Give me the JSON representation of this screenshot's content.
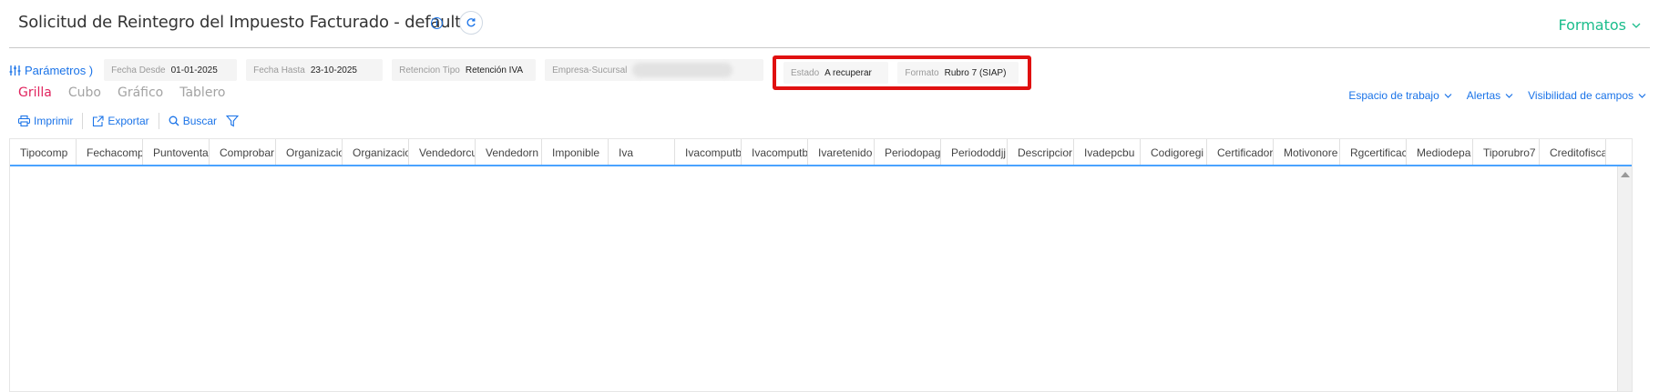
{
  "header": {
    "title": "Solicitud de Reintegro del Impuesto Facturado - default",
    "formatos_label": "Formatos"
  },
  "params": {
    "toggle_label": "Parámetros )",
    "fecha_desde": {
      "label": "Fecha Desde",
      "value": "01-01-2025"
    },
    "fecha_hasta": {
      "label": "Fecha Hasta",
      "value": "23-10-2025"
    },
    "retencion_tipo": {
      "label": "Retencion Tipo",
      "value": "Retención IVA"
    },
    "empresa_sucursal": {
      "label": "Empresa-Sucursal",
      "value": ""
    },
    "estado": {
      "label": "Estado",
      "value": "A recuperar"
    },
    "formato": {
      "label": "Formato",
      "value": "Rubro 7 (SIAP)"
    }
  },
  "view_tabs": [
    "Grilla",
    "Cubo",
    "Gráfico",
    "Tablero"
  ],
  "right_menu": [
    "Espacio de trabajo",
    "Alertas",
    "Visibilidad de campos"
  ],
  "toolbar": {
    "imprimir": "Imprimir",
    "exportar": "Exportar",
    "buscar": "Buscar"
  },
  "grid": {
    "columns": [
      "Tipocomp",
      "Fechacomp",
      "Puntoventa",
      "Comprobar",
      "Organizacio",
      "Organizacio",
      "Vendedorcu",
      "Vendedorn",
      "Imponible",
      "Iva",
      "Ivacomputb",
      "Ivacomputb",
      "Ivaretenido",
      "Periodopag",
      "Periododdjj",
      "Descripcior",
      "Ivadepcbu",
      "Codigoregi",
      "Certificador",
      "Motivonore",
      "Rgcertificac",
      "Mediodepa",
      "Tiporubro7",
      "Creditofisca"
    ]
  },
  "colors": {
    "accent_blue": "#1a73e8",
    "active_tab": "#e0245e",
    "formatos_green": "#1bbd8c",
    "highlight_red": "#e01010"
  }
}
